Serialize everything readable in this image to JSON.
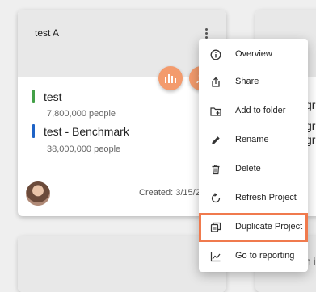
{
  "card": {
    "title": "test A",
    "series": [
      {
        "name": "test",
        "sub": "7,800,000 people",
        "color": "#43a047"
      },
      {
        "name": "test - Benchmark",
        "sub": "38,000,000 people",
        "color": "#1e63c6"
      }
    ],
    "created": "Created: 3/15/2"
  },
  "peek_card": {
    "line1": "gr",
    "line2": "gr",
    "line3": "h i"
  },
  "menu": {
    "items": [
      {
        "label": "Overview",
        "icon": "info-icon"
      },
      {
        "label": "Share",
        "icon": "share-icon"
      },
      {
        "label": "Add to folder",
        "icon": "add-folder-icon"
      },
      {
        "label": "Rename",
        "icon": "pencil-icon"
      },
      {
        "label": "Delete",
        "icon": "trash-icon"
      },
      {
        "label": "Refresh Project",
        "icon": "refresh-icon"
      },
      {
        "label": "Duplicate Project",
        "icon": "duplicate-icon"
      },
      {
        "label": "Go to reporting",
        "icon": "chart-line-icon"
      }
    ],
    "highlight_color": "#f07a4d"
  },
  "colors": {
    "fab": "#f39b6d",
    "header": "#e8e8e8"
  }
}
